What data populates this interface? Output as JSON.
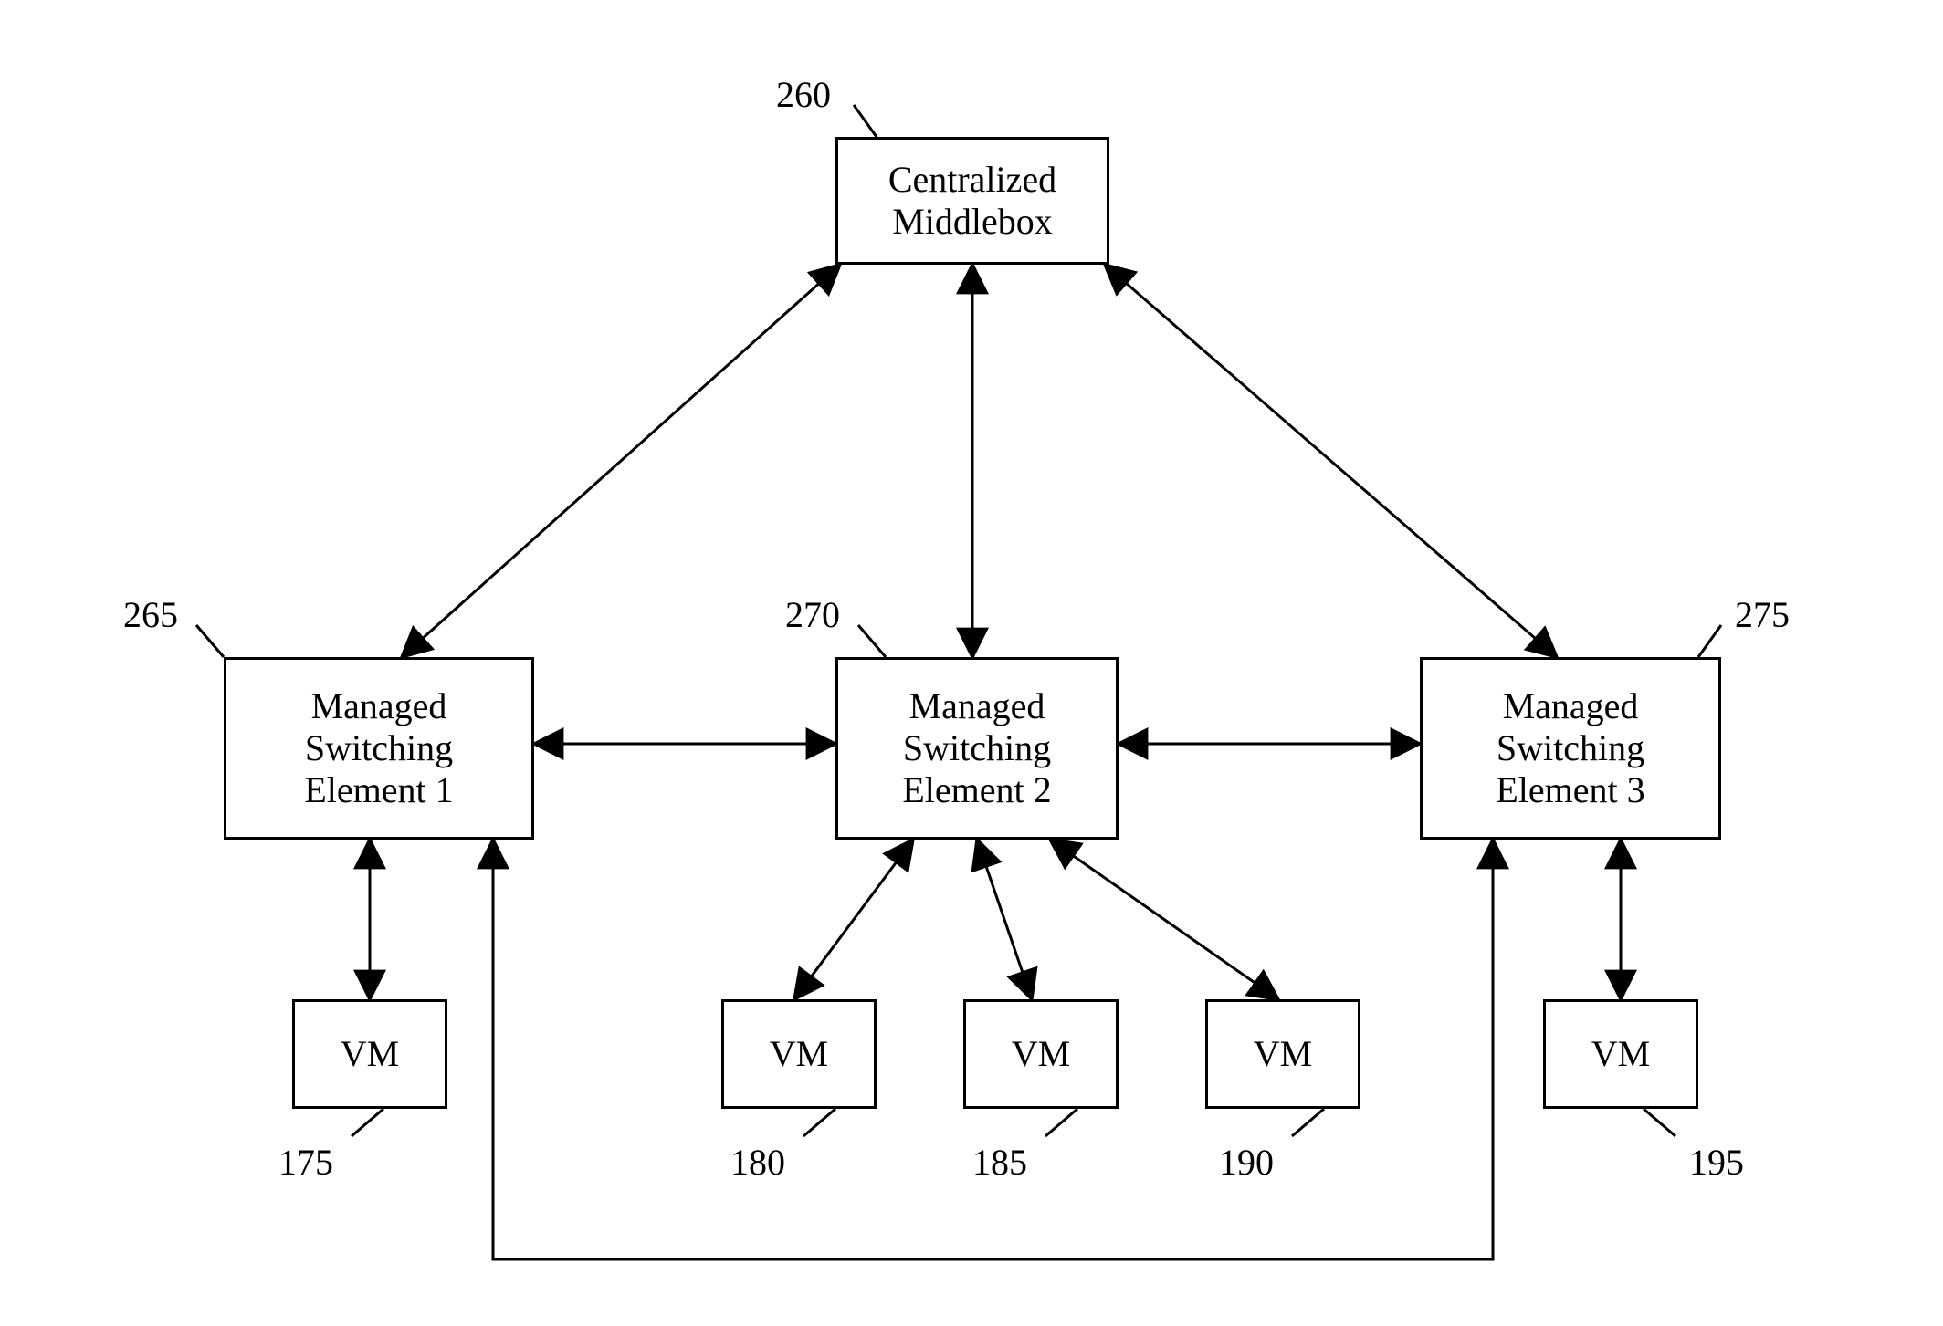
{
  "nodes": {
    "middlebox": {
      "ref": "260",
      "line1": "Centralized",
      "line2": "Middlebox"
    },
    "mse1": {
      "ref": "265",
      "line1": "Managed",
      "line2": "Switching",
      "line3": "Element 1"
    },
    "mse2": {
      "ref": "270",
      "line1": "Managed",
      "line2": "Switching",
      "line3": "Element 2"
    },
    "mse3": {
      "ref": "275",
      "line1": "Managed",
      "line2": "Switching",
      "line3": "Element 3"
    },
    "vm175": {
      "ref": "175",
      "label": "VM"
    },
    "vm180": {
      "ref": "180",
      "label": "VM"
    },
    "vm185": {
      "ref": "185",
      "label": "VM"
    },
    "vm190": {
      "ref": "190",
      "label": "VM"
    },
    "vm195": {
      "ref": "195",
      "label": "VM"
    }
  }
}
